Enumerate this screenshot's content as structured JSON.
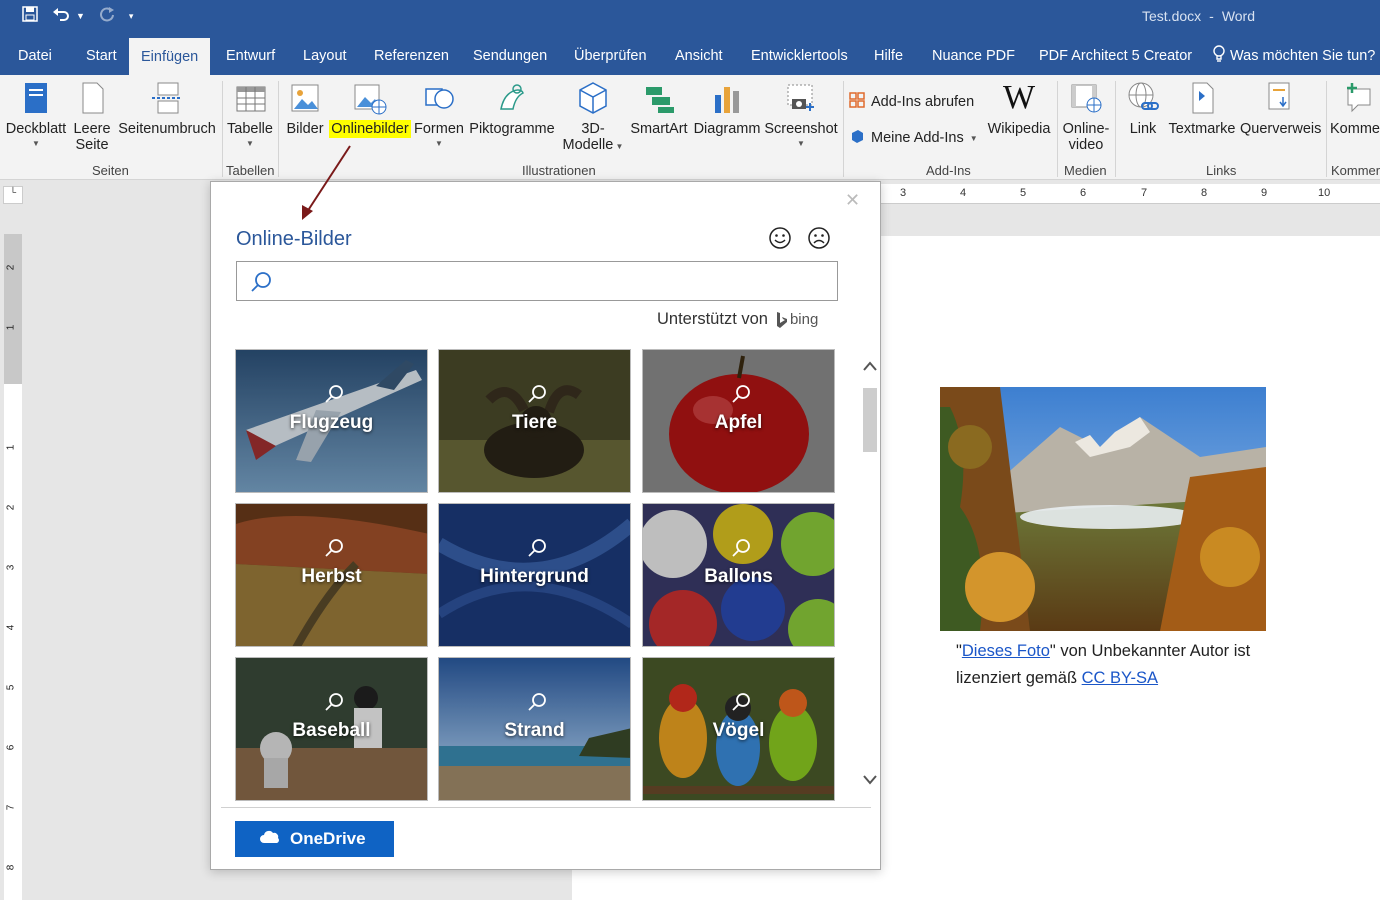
{
  "title_bar": {
    "filename": "Test.docx",
    "separator": "-",
    "app": "Word",
    "qat_icons": [
      "save-icon",
      "undo-icon",
      "redo-icon",
      "customize-icon"
    ]
  },
  "tabs": [
    "Datei",
    "Start",
    "Einfügen",
    "Entwurf",
    "Layout",
    "Referenzen",
    "Sendungen",
    "Überprüfen",
    "Ansicht",
    "Entwicklertools",
    "Hilfe",
    "Nuance PDF",
    "PDF Architect 5 Creator"
  ],
  "active_tab": "Einfügen",
  "tell_me": "Was möchten Sie tun?",
  "ribbon": {
    "deckblatt": "Deckblatt",
    "leere_seite_1": "Leere",
    "leere_seite_2": "Seite",
    "seitenumbruch": "Seitenumbruch",
    "group_seiten": "Seiten",
    "tabelle": "Tabelle",
    "group_tabellen": "Tabellen",
    "bilder": "Bilder",
    "onlinebilder": "Onlinebilder",
    "formen": "Formen",
    "piktogramme": "Piktogramme",
    "modelle_1": "3D-",
    "modelle_2": "Modelle",
    "smartart": "SmartArt",
    "diagramm": "Diagramm",
    "screenshot": "Screenshot",
    "group_illustrationen": "Illustrationen",
    "addins_abrufen": "Add-Ins abrufen",
    "meine_addins": "Meine Add-Ins",
    "wikipedia": "Wikipedia",
    "group_addins": "Add-Ins",
    "onlinevideo_1": "Online-",
    "onlinevideo_2": "video",
    "group_medien": "Medien",
    "link": "Link",
    "textmarke": "Textmarke",
    "querverweis": "Querverweis",
    "group_links": "Links",
    "kommentar": "Komme",
    "group_kommentare": "Kommer"
  },
  "ruler_h": [
    "3",
    "4",
    "5",
    "6",
    "7",
    "8",
    "9",
    "10"
  ],
  "ruler_v": [
    "2",
    "1",
    "1",
    "2",
    "3",
    "4",
    "5",
    "6",
    "7",
    "8"
  ],
  "dialog": {
    "title": "Online-Bilder",
    "search_placeholder": "",
    "powered_by": "Unterstützt von",
    "bing": "bing",
    "tiles": [
      "Flugzeug",
      "Tiere",
      "Apfel",
      "Herbst",
      "Hintergrund",
      "Ballons",
      "Baseball",
      "Strand",
      "Vögel"
    ],
    "onedrive": "OneDrive"
  },
  "caption": {
    "quote_open": "\"",
    "link1": "Dieses Foto",
    "middle": "\" von Unbekannter Autor ist lizenziert gemäß ",
    "link2": "CC BY-SA"
  },
  "colors": {
    "word_blue": "#2b579a",
    "highlight": "#ffff00",
    "onedrive_blue": "#0f63c4",
    "arrow": "#7a1a1a"
  }
}
